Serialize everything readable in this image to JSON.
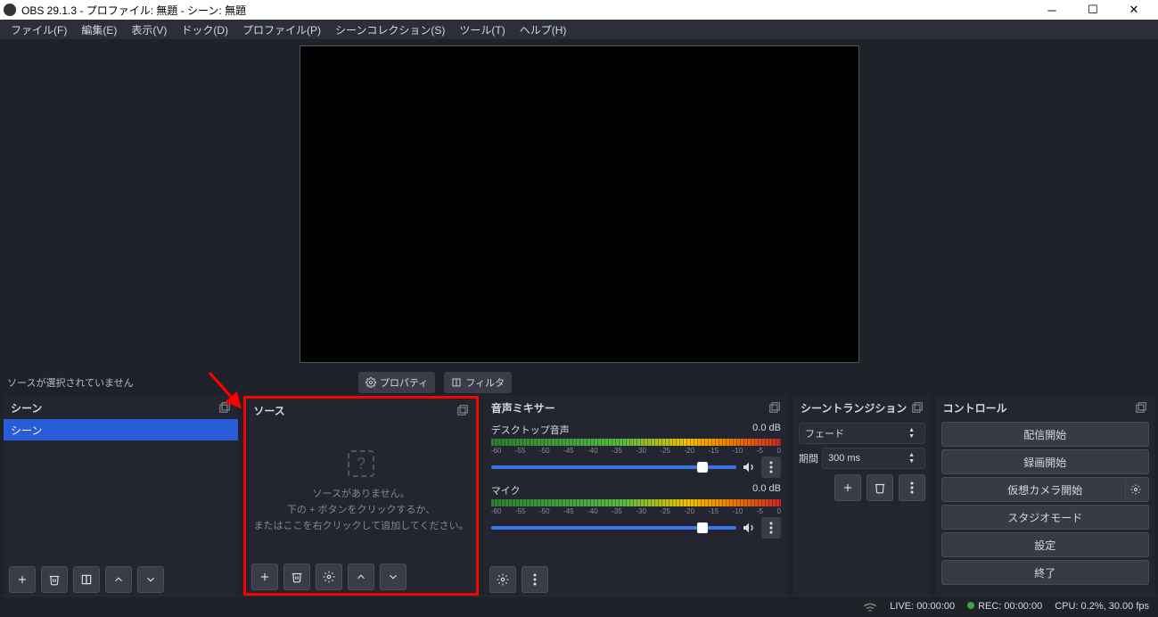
{
  "window": {
    "title": "OBS 29.1.3 - プロファイル: 無題 - シーン: 無題"
  },
  "menu": {
    "file": "ファイル(F)",
    "edit": "編集(E)",
    "view": "表示(V)",
    "dock": "ドック(D)",
    "profile": "プロファイル(P)",
    "scene_collection": "シーンコレクション(S)",
    "tools": "ツール(T)",
    "help": "ヘルプ(H)"
  },
  "toolbar": {
    "no_source_selected": "ソースが選択されていません",
    "properties": "プロパティ",
    "filters": "フィルタ"
  },
  "scenes": {
    "title": "シーン",
    "items": [
      {
        "name": "シーン"
      }
    ]
  },
  "sources": {
    "title": "ソース",
    "empty_line1": "ソースがありません。",
    "empty_line2": "下の + ボタンをクリックするか、",
    "empty_line3": "またはここを右クリックして追加してください。"
  },
  "mixer": {
    "title": "音声ミキサー",
    "tracks": [
      {
        "name": "デスクトップ音声",
        "db": "0.0 dB",
        "scale": [
          "-60",
          "-55",
          "-50",
          "-45",
          "-40",
          "-35",
          "-30",
          "-25",
          "-20",
          "-15",
          "-10",
          "-5",
          "0"
        ]
      },
      {
        "name": "マイク",
        "db": "0.0 dB",
        "scale": [
          "-60",
          "-55",
          "-50",
          "-45",
          "-40",
          "-35",
          "-30",
          "-25",
          "-20",
          "-15",
          "-10",
          "-5",
          "0"
        ]
      }
    ]
  },
  "transitions": {
    "title": "シーントランジション",
    "selected": "フェード",
    "duration_label": "期間",
    "duration": "300 ms"
  },
  "controls": {
    "title": "コントロール",
    "start_stream": "配信開始",
    "start_record": "録画開始",
    "start_virtualcam": "仮想カメラ開始",
    "studio_mode": "スタジオモード",
    "settings": "設定",
    "exit": "終了"
  },
  "status": {
    "live": "LIVE: 00:00:00",
    "rec": "REC: 00:00:00",
    "cpu": "CPU: 0.2%, 30.00 fps"
  }
}
